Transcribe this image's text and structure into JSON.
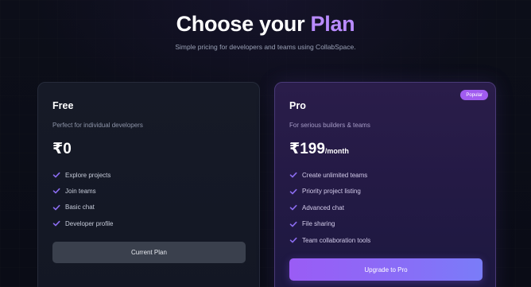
{
  "header": {
    "title_main": "Choose your",
    "title_accent": "Plan",
    "subtitle": "Simple pricing for developers and teams using CollabSpace."
  },
  "plans": [
    {
      "name": "Free",
      "description": "Perfect for individual developers",
      "price": "₹0",
      "period": "",
      "features": [
        "Explore projects",
        "Join teams",
        "Basic chat",
        "Developer profile"
      ],
      "button_label": "Current Plan"
    },
    {
      "name": "Pro",
      "badge": "Popular",
      "description": "For serious builders & teams",
      "price": "₹199",
      "period": "/month",
      "features": [
        "Create unlimited teams",
        "Priority project listing",
        "Advanced chat",
        "File sharing",
        "Team collaboration tools"
      ],
      "button_label": "Upgrade to Pro"
    }
  ],
  "icons": {
    "feature_check": "check-icon"
  },
  "colors": {
    "accent": "#b98bff",
    "check": "#8b6cf0",
    "badge": "#a15cf0",
    "upgrade_gradient_start": "#9a5cf5",
    "upgrade_gradient_end": "#7a7cf8"
  }
}
